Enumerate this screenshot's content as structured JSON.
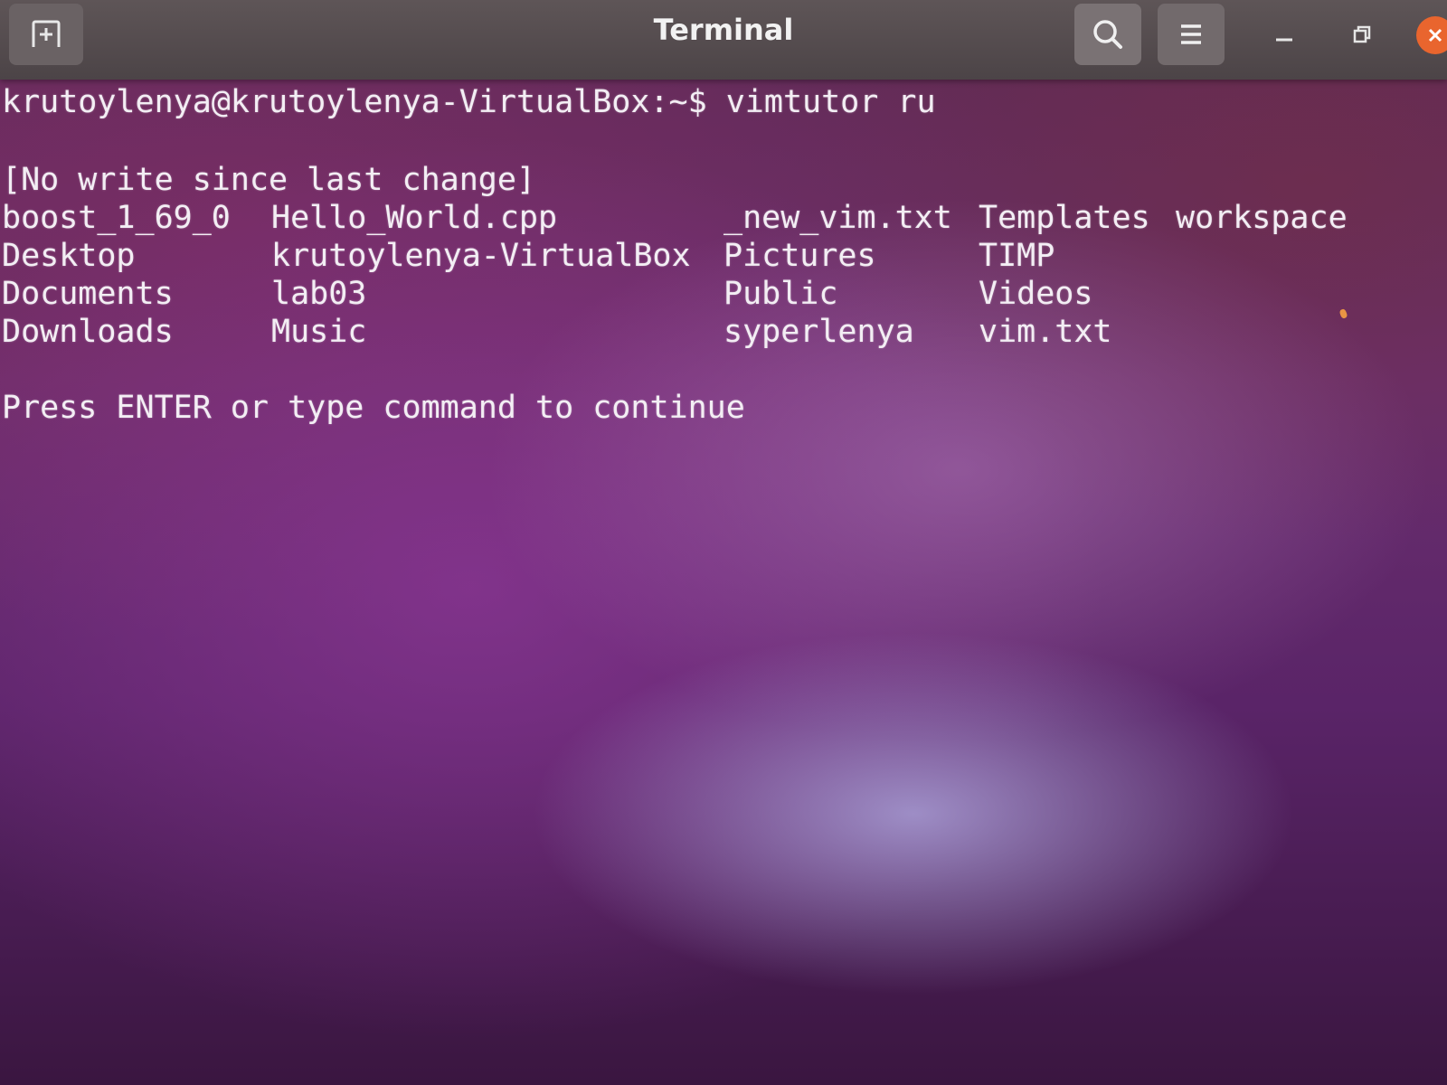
{
  "window": {
    "title": "Terminal",
    "accent": "#e9652e"
  },
  "titlebar": {
    "new_tab_icon": "new-tab-icon",
    "search_icon": "search-icon",
    "menu_icon": "hamburger-menu-icon",
    "minimize_icon": "minimize-icon",
    "maximize_icon": "maximize-icon",
    "close_icon": "close-icon"
  },
  "terminal": {
    "prompt": "krutoylenya@krutoylenya-VirtualBox:~$ vimtutor ru",
    "status": "[No write since last change]",
    "listing": [
      [
        "boost_1_69_0",
        "Hello_World.cpp",
        "_new_vim.txt",
        "Templates",
        "workspace"
      ],
      [
        "Desktop",
        "krutoylenya-VirtualBox",
        "Pictures",
        "TIMP",
        ""
      ],
      [
        "Documents",
        "lab03",
        "Public",
        "Videos",
        ""
      ],
      [
        "Downloads",
        "Music",
        "syperlenya",
        "vim.txt",
        ""
      ]
    ],
    "continue_message": "Press ENTER or type command to continue"
  }
}
